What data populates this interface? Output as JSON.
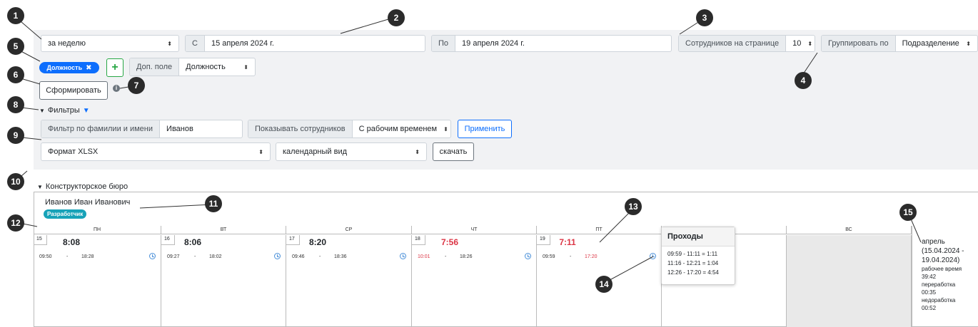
{
  "controls": {
    "period": "за неделю",
    "from_label": "С",
    "from_value": "15 апреля 2024 г.",
    "to_label": "По",
    "to_value": "19 апреля 2024 г.",
    "per_page_label": "Сотрудников на странице",
    "per_page_value": "10",
    "group_label": "Группировать по",
    "group_value": "Подразделение",
    "tag": "Должность",
    "add_field_label": "Доп. поле",
    "add_field_value": "Должность",
    "form_button": "Сформировать"
  },
  "filters": {
    "header": "Фильтры",
    "name_label": "Фильтр по фамилии и имени",
    "name_value": "Иванов",
    "show_label": "Показывать сотрудников",
    "show_value": "С рабочим временем",
    "apply_button": "Применить",
    "format_value": "Формат XLSX",
    "view_value": "календарный вид",
    "download_button": "скачать"
  },
  "group": {
    "title": "Конструкторское бюро",
    "employee": "Иванов Иван Иванович",
    "badge": "Разработчик"
  },
  "week": {
    "days": [
      {
        "label": "ПН",
        "num": "15",
        "total": "8:08",
        "start": "09:50",
        "sep": "-",
        "end": "18:28",
        "late": false,
        "short": false
      },
      {
        "label": "ВТ",
        "num": "16",
        "total": "8:06",
        "start": "09:27",
        "sep": "-",
        "end": "18:02",
        "late": false,
        "short": false
      },
      {
        "label": "СР",
        "num": "17",
        "total": "8:20",
        "start": "09:46",
        "sep": "-",
        "end": "18:36",
        "late": false,
        "short": false
      },
      {
        "label": "ЧТ",
        "num": "18",
        "total": "7:56",
        "start": "10:01",
        "sep": "-",
        "end": "18:26",
        "late": true,
        "short": true
      },
      {
        "label": "ПТ",
        "num": "19",
        "total": "7:11",
        "start": "09:59",
        "sep": "-",
        "end": "17:20",
        "late": false,
        "short": true
      },
      {
        "label": "",
        "num": "",
        "total": "",
        "start": "",
        "sep": "",
        "end": ""
      },
      {
        "label": "ВС",
        "num": "",
        "total": "",
        "start": "",
        "sep": "",
        "end": ""
      }
    ],
    "tooltip": {
      "title": "Проходы",
      "lines": [
        "09:59 - 11:11 = 1:11",
        "11:16 - 12:21 = 1:04",
        "12:26 - 17:20 = 4:54"
      ]
    },
    "summary": {
      "month": "апрель",
      "range": "(15.04.2024 - 19.04.2024)",
      "work_label": "рабочее время",
      "work_value": "39:42",
      "over_label": "переработка",
      "over_value": "00:35",
      "under_label": "недоработка",
      "under_value": "00:52"
    }
  },
  "callouts": [
    "1",
    "2",
    "3",
    "4",
    "5",
    "6",
    "7",
    "8",
    "9",
    "10",
    "11",
    "12",
    "13",
    "14",
    "15"
  ],
  "colors": {
    "accent": "#0d6efd",
    "badge": "#17a2b8",
    "late": "#dc3545",
    "pane": "#f1f2f4",
    "callout": "#2b2b2b"
  }
}
